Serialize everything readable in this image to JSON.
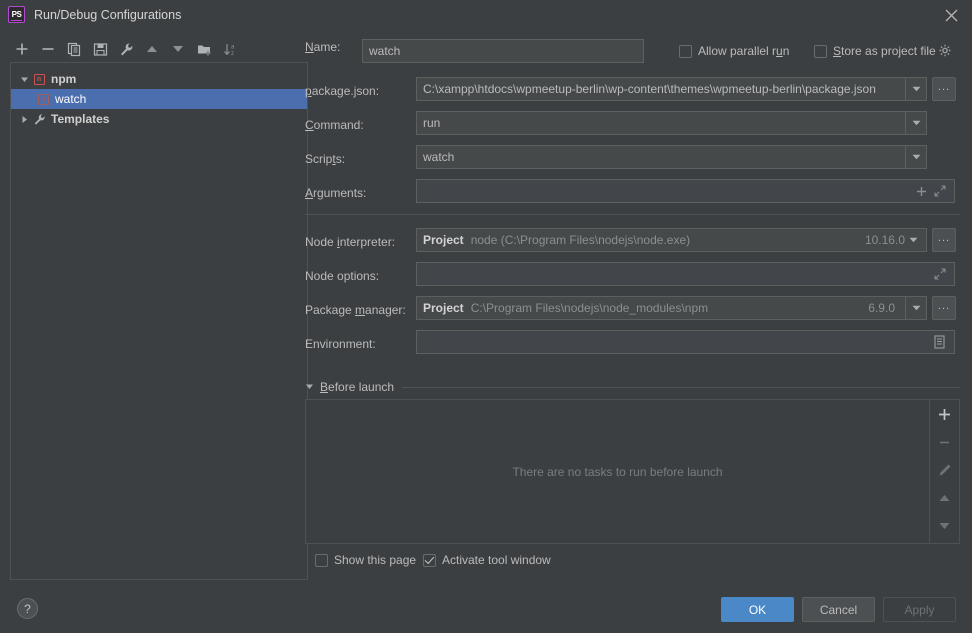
{
  "window": {
    "title": "Run/Debug Configurations",
    "app_icon": "PS",
    "close_icon": "close-icon"
  },
  "toolbar": {
    "items": [
      {
        "name": "add-configuration-button",
        "icon": "plus-icon"
      },
      {
        "name": "remove-configuration-button",
        "icon": "minus-icon"
      },
      {
        "name": "copy-configuration-button",
        "icon": "copy-icon"
      },
      {
        "name": "save-configuration-button",
        "icon": "save-icon"
      },
      {
        "name": "edit-templates-button",
        "icon": "wrench-icon"
      },
      {
        "name": "move-up-button",
        "icon": "arrow-up-icon"
      },
      {
        "name": "move-down-button",
        "icon": "arrow-down-icon"
      },
      {
        "name": "new-folder-button",
        "icon": "folder-add-icon"
      },
      {
        "name": "sort-configurations-button",
        "icon": "sort-az-icon"
      }
    ]
  },
  "tree": {
    "nodes": [
      {
        "label": "npm",
        "icon": "npm-icon",
        "expanded": true,
        "bold": true,
        "selected": false,
        "indent": 0
      },
      {
        "label": "watch",
        "icon": "npm-icon",
        "expanded": null,
        "bold": false,
        "selected": true,
        "indent": 1
      },
      {
        "label": "Templates",
        "icon": "wrench-icon",
        "expanded": false,
        "bold": true,
        "selected": false,
        "indent": 0
      }
    ]
  },
  "form": {
    "name": {
      "label": "Name:",
      "label_mnemonic": "N",
      "value": "watch",
      "placeholder": ""
    },
    "allow_parallel_run": {
      "label": "Allow parallel run",
      "checked": false
    },
    "store_as_project_file": {
      "label": "Store as project file",
      "checked": false,
      "gear_icon": "gear-icon"
    },
    "package_json": {
      "label": "package.json:",
      "label_mnemonic": "p",
      "value": "C:\\xampp\\htdocs\\wpmeetup-berlin\\wp-content\\themes\\wpmeetup-berlin\\package.json",
      "browse_label": "...",
      "dropdown_icon": "chevron-down-icon"
    },
    "command": {
      "label": "Command:",
      "label_mnemonic": "C",
      "value": "run",
      "dropdown_icon": "chevron-down-icon"
    },
    "scripts": {
      "label": "Scripts:",
      "label_mnemonic": "t",
      "value": "watch",
      "dropdown_icon": "chevron-down-icon"
    },
    "arguments": {
      "label": "Arguments:",
      "label_mnemonic": "A",
      "value": "",
      "add_icon": "plus-icon",
      "expand_icon": "expand-icon"
    },
    "node_interpreter": {
      "label": "Node interpreter:",
      "label_mnemonic": "i",
      "scope": "Project",
      "value": "node (C:\\Program Files\\nodejs\\node.exe)",
      "version": "10.16.0",
      "browse_label": "...",
      "dropdown_icon": "chevron-down-icon"
    },
    "node_options": {
      "label": "Node options:",
      "value": "",
      "expand_icon": "expand-icon"
    },
    "package_manager": {
      "label": "Package manager:",
      "label_mnemonic": "m",
      "scope": "Project",
      "value": "C:\\Program Files\\nodejs\\node_modules\\npm",
      "version": "6.9.0",
      "browse_label": "...",
      "dropdown_icon": "chevron-down-icon"
    },
    "environment": {
      "label": "Environment:",
      "value": "",
      "editor_icon": "list-editor-icon"
    }
  },
  "before_launch": {
    "title": "Before launch",
    "title_mnemonic": "B",
    "expanded": true,
    "empty_message": "There are no tasks to run before launch",
    "side_buttons": [
      {
        "name": "add-task-button",
        "icon": "plus-icon",
        "enabled": true
      },
      {
        "name": "remove-task-button",
        "icon": "minus-icon",
        "enabled": false
      },
      {
        "name": "edit-task-button",
        "icon": "pencil-icon",
        "enabled": false
      },
      {
        "name": "move-task-up-button",
        "icon": "arrow-up-icon",
        "enabled": false
      },
      {
        "name": "move-task-down-button",
        "icon": "arrow-down-icon",
        "enabled": false
      }
    ],
    "show_this_page": {
      "label": "Show this page",
      "checked": false
    },
    "activate_tool_window": {
      "label": "Activate tool window",
      "checked": true
    }
  },
  "footer": {
    "help_label": "?",
    "ok_label": "OK",
    "cancel_label": "Cancel",
    "apply_label": "Apply",
    "apply_enabled": false
  },
  "colors": {
    "background": "#3c3f41",
    "field_background": "#45494a",
    "selection": "#4b6eaf",
    "accent": "#4a88c7",
    "npm_red": "#c75450",
    "border": "#5e6060"
  }
}
